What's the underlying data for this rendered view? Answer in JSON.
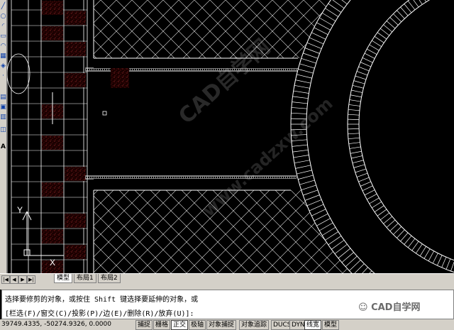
{
  "toolbar": {
    "icons": [
      "draw-line-icon",
      "circle-icon",
      "arc-icon",
      "rectangle-icon",
      "polyline-icon",
      "hatch-icon",
      "insert-block-icon",
      "point-icon",
      "table-icon",
      "region-icon",
      "text-icon"
    ],
    "text_label": "A"
  },
  "drawing": {
    "ucs_y": "Y",
    "ucs_x": "X",
    "background_color": "#000000",
    "line_color": "#ffffff",
    "hatch_color": "#7a1414"
  },
  "watermark": {
    "main": "CAD自学网",
    "sub": "www.cadzxw.com"
  },
  "tabs": {
    "nav": [
      "|◀",
      "◀",
      "▶",
      "▶|"
    ],
    "items": [
      {
        "label": "模型",
        "active": true
      },
      {
        "label": "布局1",
        "active": false
      },
      {
        "label": "布局2",
        "active": false
      }
    ]
  },
  "command": {
    "line1": "选择要修剪的对象，或按住 Shift 键选择要延伸的对象，或",
    "line2": "[栏选(F)/窗交(C)/投影(P)/边(E)/删除(R)/放弃(U)]:"
  },
  "logo": "CAD自学网",
  "status": {
    "coords": "39749.4335, -50274.9326, 0.0000",
    "buttons": [
      {
        "label": "捕捉",
        "on": false
      },
      {
        "label": "栅格",
        "on": false
      },
      {
        "label": "正交",
        "on": true
      },
      {
        "label": "极轴",
        "on": false
      },
      {
        "label": "对象捕捉",
        "on": false
      },
      {
        "label": "对象追踪",
        "on": false
      },
      {
        "label": "DUCS",
        "on": false
      },
      {
        "label": "DYN",
        "on": false
      },
      {
        "label": "线宽",
        "on": true
      },
      {
        "label": "模型",
        "on": false
      }
    ]
  }
}
